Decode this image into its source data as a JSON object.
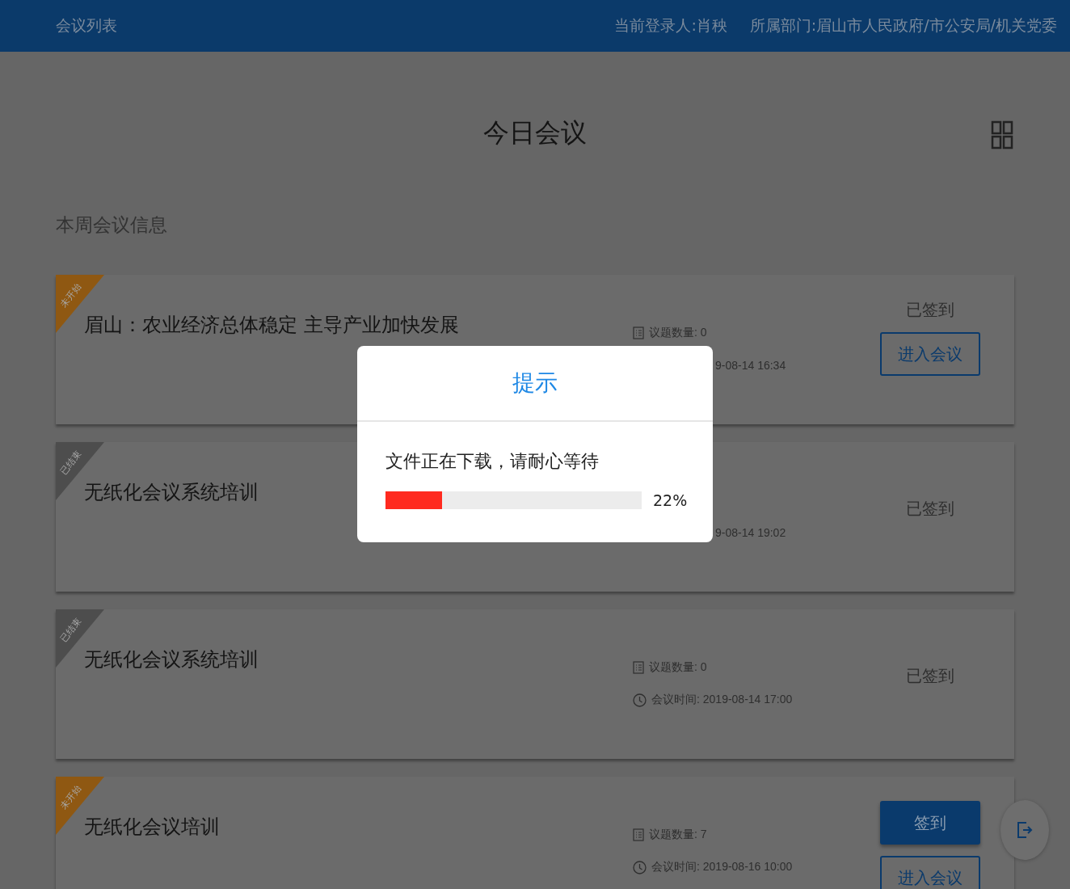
{
  "header": {
    "title": "会议列表",
    "user": "当前登录人:肖秧",
    "department": "所属部门:眉山市人民政府/市公安局/机关党委"
  },
  "page_title": "今日会议",
  "section_title": "本周会议信息",
  "meetings": [
    {
      "badge": {
        "text": "未开始",
        "color": "#8f5812"
      },
      "title": "眉山：农业经济总体稳定 主导产业加快发展",
      "topics": "议题数量: 0",
      "time": "9-08-14 16:34",
      "time_partial": true,
      "actions": [
        {
          "kind": "status",
          "label": "已签到"
        },
        {
          "kind": "outline",
          "label": "进入会议"
        }
      ]
    },
    {
      "badge": {
        "text": "已结束",
        "color": "#4d4d4d"
      },
      "title": "无纸化会议系统培训",
      "time": "9-08-14 19:02",
      "time_partial": true,
      "actions": [
        {
          "kind": "status",
          "label": "已签到"
        }
      ]
    },
    {
      "badge": {
        "text": "已结束",
        "color": "#4d4d4d"
      },
      "title": "无纸化会议系统培训",
      "topics": "议题数量: 0",
      "time": "会议时间: 2019-08-14 17:00",
      "time_partial": false,
      "actions": [
        {
          "kind": "status",
          "label": "已签到"
        }
      ]
    },
    {
      "badge": {
        "text": "未开始",
        "color": "#8f5812"
      },
      "title": "无纸化会议培训",
      "topics": "议题数量: 7",
      "time": "会议时间: 2019-08-16 10:00",
      "time_partial": false,
      "actions": [
        {
          "kind": "primary",
          "label": "签到"
        },
        {
          "kind": "outline",
          "label": "进入会议"
        }
      ]
    }
  ],
  "dialog": {
    "title": "提示",
    "message": "文件正在下载，请耐心等待",
    "level": 0.22,
    "reading": "22%"
  }
}
